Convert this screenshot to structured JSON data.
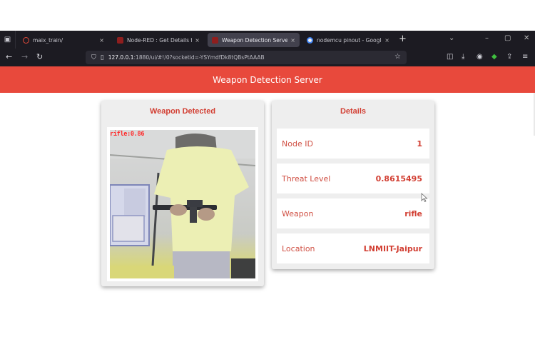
{
  "browser": {
    "tabs": [
      {
        "title": "maix_train/",
        "active": false,
        "favicon_color": "#e24a3a"
      },
      {
        "title": "Node-RED : Get Details from M",
        "active": false,
        "favicon_color": "#8f1e1e"
      },
      {
        "title": "Weapon Detection Server",
        "active": true,
        "favicon_color": "#8f1e1e"
      },
      {
        "title": "nodemcu pinout - Google Sear",
        "active": false,
        "favicon_color": "#4285f4"
      }
    ],
    "url_host": "127.0.0.1",
    "url_rest": ":1880/ui/#!/0?socketid=-YSYmdfDk8tQBsPtAAAB",
    "new_tab_glyph": "+",
    "close_glyph": "×"
  },
  "app": {
    "title": "Weapon Detection Server",
    "accent_color": "#e8493c"
  },
  "weapon_card": {
    "title": "Weapon Detected",
    "overlay_label": "rifle:0.86"
  },
  "details_card": {
    "title": "Details",
    "rows": [
      {
        "label": "Node ID",
        "value": "1"
      },
      {
        "label": "Threat Level",
        "value": "0.8615495"
      },
      {
        "label": "Weapon",
        "value": "rifle"
      },
      {
        "label": "Location",
        "value": "LNMIIT-Jaipur"
      }
    ]
  }
}
